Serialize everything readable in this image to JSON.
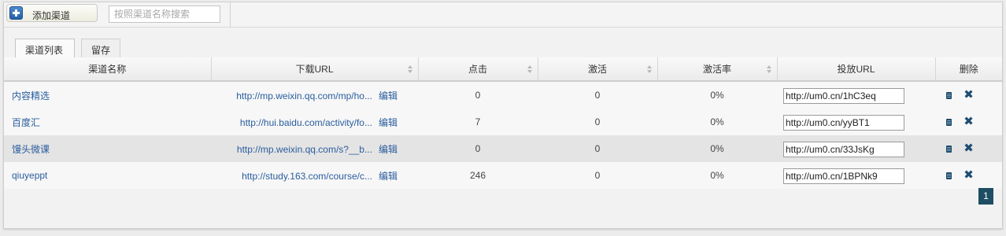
{
  "toolbar": {
    "add_label": "添加渠道",
    "search_placeholder": "按照渠道名称搜索"
  },
  "tabs": [
    {
      "label": "渠道列表",
      "active": true
    },
    {
      "label": "留存",
      "active": false
    }
  ],
  "table": {
    "headers": {
      "name": "渠道名称",
      "download_url": "下载URL",
      "clicks": "点击",
      "activations": "激活",
      "activation_rate": "激活率",
      "put_url": "投放URL",
      "delete": "删除"
    },
    "edit_label": "编辑",
    "rows": [
      {
        "name": "内容精选",
        "download_url": "http://mp.weixin.qq.com/mp/ho...",
        "clicks": "0",
        "activations": "0",
        "rate": "0%",
        "put_url": "http://um0.cn/1hC3eq"
      },
      {
        "name": "百度汇",
        "download_url": "http://hui.baidu.com/activity/fo...",
        "clicks": "7",
        "activations": "0",
        "rate": "0%",
        "put_url": "http://um0.cn/yyBT1"
      },
      {
        "name": "馒头微课",
        "download_url": "http://mp.weixin.qq.com/s?__b...",
        "clicks": "0",
        "activations": "0",
        "rate": "0%",
        "put_url": "http://um0.cn/33JsKg"
      },
      {
        "name": "qiuyeppt",
        "download_url": "http://study.163.com/course/c...",
        "clicks": "246",
        "activations": "0",
        "rate": "0%",
        "put_url": "http://um0.cn/1BPNk9"
      }
    ]
  },
  "pagination": {
    "current_page": "1"
  },
  "icons": {
    "add": "plus-square-icon",
    "copy": "copy-icon",
    "delete": "close-icon",
    "sort": "sort-icon"
  },
  "colors": {
    "link": "#2a5d9e",
    "pager_bg": "#1d4e64",
    "add_icon": "#2460a8"
  }
}
